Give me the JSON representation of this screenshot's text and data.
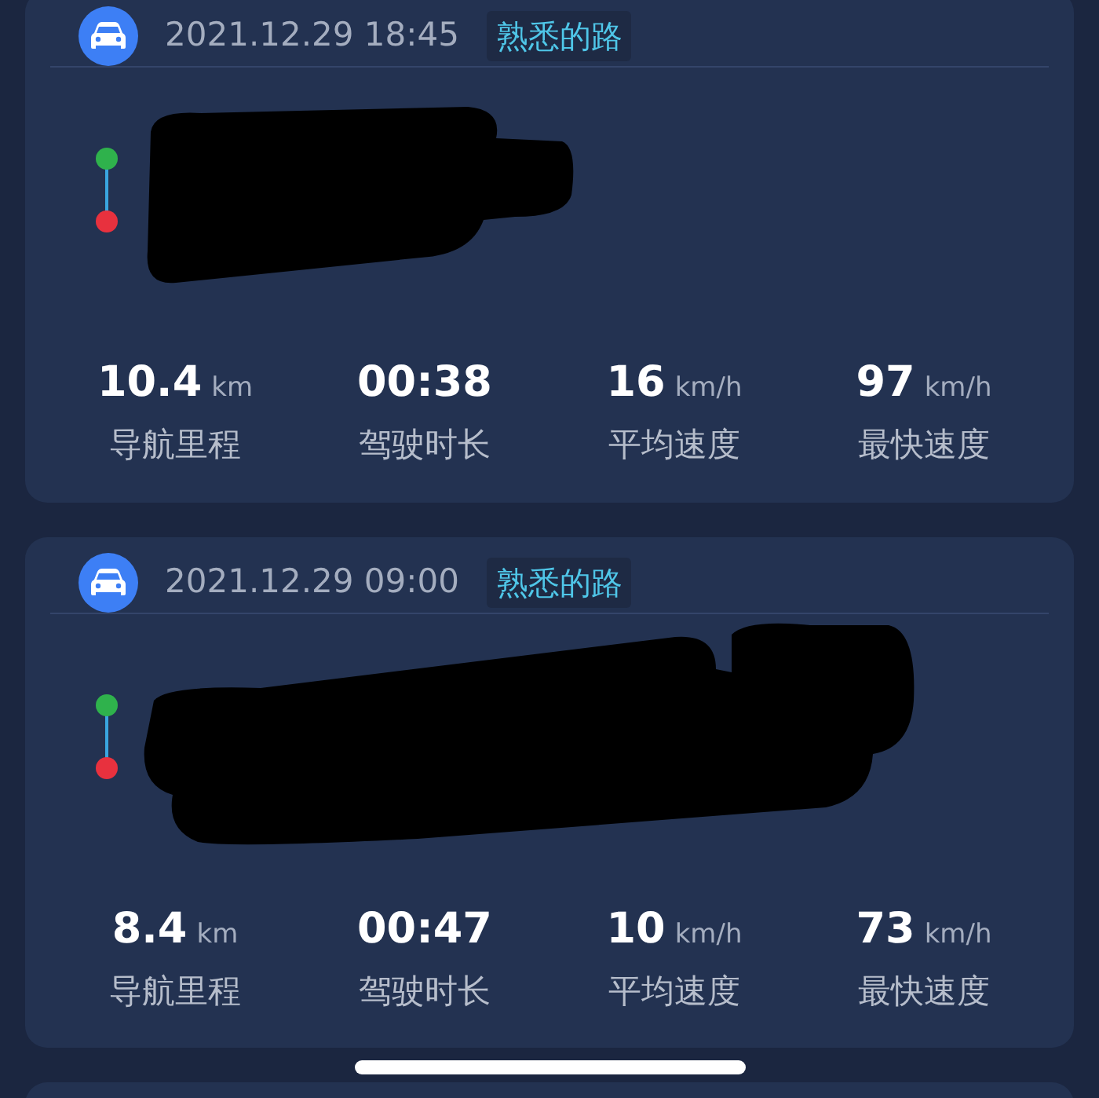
{
  "trips": [
    {
      "time": "2021.12.29 18:45",
      "tag": "熟悉的路",
      "redaction": {
        "kind": "short"
      },
      "stats": [
        {
          "value": "10.4",
          "unit": "km",
          "label": "导航里程"
        },
        {
          "value": "00:38",
          "label": "驾驶时长"
        },
        {
          "value": "16",
          "unit": "km/h",
          "label": "平均速度"
        },
        {
          "value": "97",
          "unit": "km/h",
          "label": "最快速度"
        }
      ]
    },
    {
      "time": "2021.12.29 09:00",
      "tag": "熟悉的路",
      "redaction": {
        "kind": "long"
      },
      "stats": [
        {
          "value": "8.4",
          "unit": "km",
          "label": "导航里程"
        },
        {
          "value": "00:47",
          "label": "驾驶时长"
        },
        {
          "value": "10",
          "unit": "km/h",
          "label": "平均速度"
        },
        {
          "value": "73",
          "unit": "km/h",
          "label": "最快速度"
        }
      ]
    }
  ]
}
